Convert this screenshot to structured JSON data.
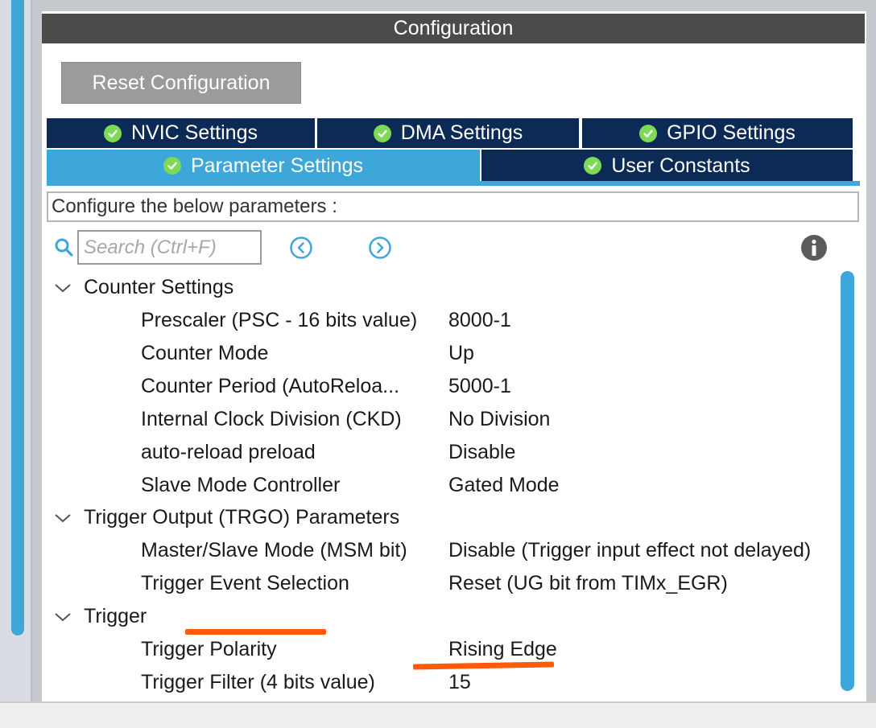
{
  "header": {
    "title": "Configuration"
  },
  "toolbar": {
    "reset_label": "Reset Configuration"
  },
  "tabs": [
    {
      "label": "NVIC Settings",
      "active": false
    },
    {
      "label": "DMA Settings",
      "active": false
    },
    {
      "label": "GPIO Settings",
      "active": false
    },
    {
      "label": "Parameter Settings",
      "active": true
    },
    {
      "label": "User Constants",
      "active": false
    }
  ],
  "description": "Configure the below parameters :",
  "search": {
    "placeholder": "Search (Ctrl+F)"
  },
  "groups": [
    {
      "label": "Counter Settings",
      "params": [
        {
          "name": "Prescaler (PSC - 16 bits value)",
          "value": "8000-1"
        },
        {
          "name": "Counter Mode",
          "value": "Up"
        },
        {
          "name": "Counter Period (AutoReloa...",
          "value": "5000-1"
        },
        {
          "name": "Internal Clock Division (CKD)",
          "value": "No Division"
        },
        {
          "name": "auto-reload preload",
          "value": "Disable"
        },
        {
          "name": "Slave Mode Controller",
          "value": "Gated Mode"
        }
      ]
    },
    {
      "label": "Trigger Output (TRGO) Parameters",
      "params": [
        {
          "name": "Master/Slave Mode (MSM bit)",
          "value": "Disable (Trigger input effect not delayed)"
        },
        {
          "name": "Trigger Event Selection",
          "value": "Reset (UG bit from TIMx_EGR)"
        }
      ]
    },
    {
      "label": "Trigger",
      "params": [
        {
          "name": "Trigger Polarity",
          "value": "Rising Edge"
        },
        {
          "name": "Trigger Filter (4 bits value)",
          "value": "15"
        }
      ]
    }
  ],
  "colors": {
    "tab_dark": "#0c2a56",
    "tab_active": "#3ea7d9",
    "header_bg": "#4b4b4b",
    "check_green": "#7ed957",
    "annotation": "#ff5a0a"
  },
  "icons": [
    "search-icon",
    "prev-arrow-icon",
    "next-arrow-icon",
    "info-icon",
    "check-icon",
    "chevron-down-icon"
  ]
}
